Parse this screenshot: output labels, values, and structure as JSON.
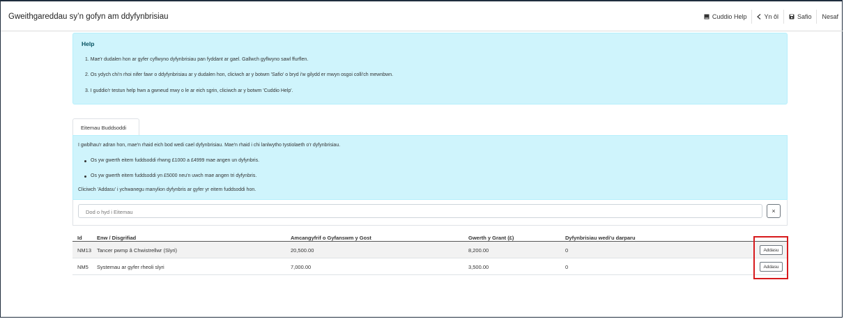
{
  "page": {
    "title": "Gweithgareddau sy’n gofyn am ddyfynbrisiau"
  },
  "toolbar": {
    "hide_help": "Cuddio Help",
    "back": "Yn ôl",
    "save": "Safio",
    "next": "Nesaf"
  },
  "help": {
    "heading": "Help",
    "lines": [
      "1. Mae'r dudalen hon ar gyfer cyflwyno dyfynbrisiau pan fyddant ar gael. Gallwch gyflwyno sawl ffurflen.",
      "2. Os ydych chi'n rhoi nifer fawr o ddyfynbrisiau ar y dudalen hon, cliciwch ar y botwm 'Safio' o bryd i'w gilydd er mwyn osgoi colli'ch mewnbwn.",
      "3. I guddio'r testun help hwn a gwneud mwy o le ar eich sgrin, cliciwch ar y botwm 'Cuddio Help'."
    ]
  },
  "tab": {
    "label": "Eitemau Buddsoddi"
  },
  "info": {
    "intro": "I gwblhau'r adran hon, mae'n rhaid eich bod wedi cael dyfynbrisiau. Mae'n rhaid i chi lanlwytho tystiolaeth o'r dyfynbrisiau.",
    "bullets": [
      "Os yw gwerth eitem fuddsoddi rhwng £1000 a £4999 mae angen un dyfynbris.",
      "Os yw gwerth eitem fuddsoddi yn £5000 neu'n uwch mae angen tri dyfynbris."
    ],
    "outro": "Cliciwch 'Addasu' i ychwanegu manylion dyfynbris ar gyfer yr eitem fuddsoddi hon."
  },
  "filter": {
    "placeholder": "Dod o hyd i Eitemau",
    "clear": "×"
  },
  "table": {
    "headers": {
      "id": "Id",
      "name": "Enw / Disgrifiad",
      "cost": "Amcangyfrif o Gyfanswm y Gost",
      "grant": "Gwerth y Grant (£)",
      "quotes": "Dyfynbrisiau wedi'u darparu"
    },
    "rows": [
      {
        "id": "NM13",
        "name": "Tancer pwmp â Chwistrellwr (Slyri)",
        "cost": "20,500.00",
        "grant": "8,200.00",
        "quotes": "0",
        "action": "Addasu"
      },
      {
        "id": "NM5",
        "name": "Systemau ar gyfer rheoli slyri",
        "cost": "7,000.00",
        "grant": "3,500.00",
        "quotes": "0",
        "action": "Addasu"
      }
    ]
  },
  "colors": {
    "info_bg": "#cff4fc",
    "highlight": "#d7191c"
  }
}
